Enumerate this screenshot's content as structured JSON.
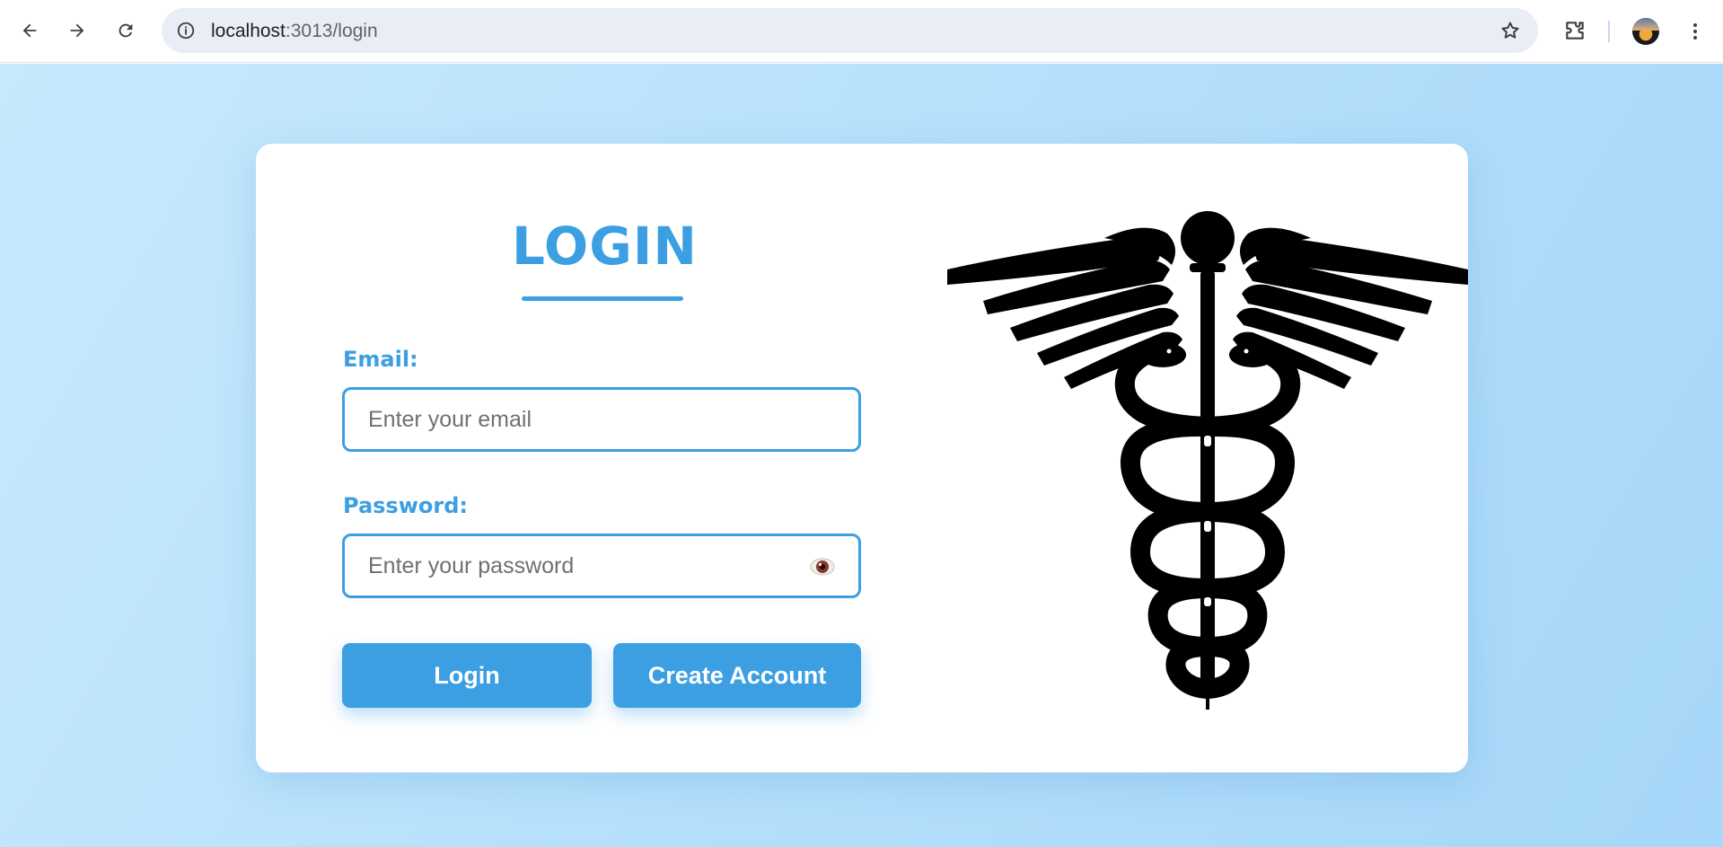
{
  "browser": {
    "url_host": "localhost",
    "url_rest": ":3013/login",
    "back_icon": "back-arrow-icon",
    "forward_icon": "forward-arrow-icon",
    "reload_icon": "reload-icon"
  },
  "login": {
    "title": "LOGIN",
    "email_label": "Email:",
    "email_placeholder": "Enter your email",
    "password_label": "Password:",
    "password_placeholder": "Enter your password",
    "login_button": "Login",
    "create_account_button": "Create Account"
  },
  "colors": {
    "accent": "#3c9fe2",
    "background": "#b5e0fb",
    "card": "#ffffff"
  },
  "logo": "caduceus-logo"
}
